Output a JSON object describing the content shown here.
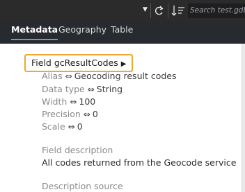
{
  "toolbar": {
    "search_placeholder": "Search test.gdb"
  },
  "tabs": [
    {
      "label": "Metadata"
    },
    {
      "label": "Geography"
    },
    {
      "label": "Table"
    }
  ],
  "field": {
    "title": "Field gcResultCodes",
    "properties": [
      {
        "label": "Alias",
        "link": "⇔",
        "value": "Geocoding result codes"
      },
      {
        "label": "Data type",
        "link": "⇔",
        "value": "String"
      },
      {
        "label": "Width",
        "link": "⇔",
        "value": "100"
      },
      {
        "label": "Precision",
        "link": "⇔",
        "value": "0"
      },
      {
        "label": "Scale",
        "link": "⇔",
        "value": "0"
      }
    ],
    "description_label": "Field description",
    "description_text": "All codes returned from the Geocode service",
    "description_source_label": "Description source"
  },
  "colors": {
    "highlight_border": "#f0a830",
    "active_tab_underline": "#5aa0e6",
    "chrome_bg": "#272a2f"
  }
}
